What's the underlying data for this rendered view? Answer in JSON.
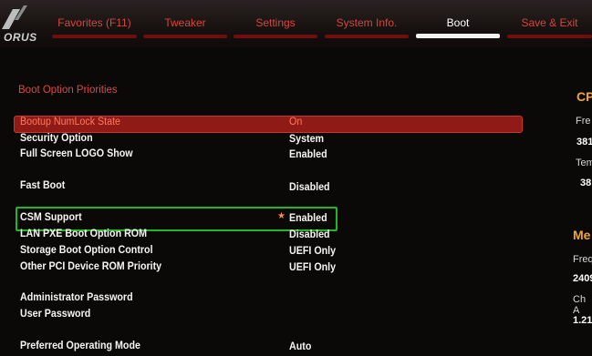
{
  "header": {
    "logo_text": "ORUS",
    "tabs": [
      {
        "label": "Favorites (F11)"
      },
      {
        "label": "Tweaker"
      },
      {
        "label": "Settings"
      },
      {
        "label": "System Info."
      },
      {
        "label": "Boot"
      },
      {
        "label": "Save & Exit"
      }
    ],
    "active_tab": "Boot"
  },
  "main": {
    "section_title": "Boot Option Priorities",
    "options": [
      {
        "label": "Bootup NumLock State",
        "value": "On"
      },
      {
        "label": "Security Option",
        "value": "System"
      },
      {
        "label": "Full Screen LOGO Show",
        "value": "Enabled"
      },
      {
        "label": "Fast Boot",
        "value": "Disabled"
      },
      {
        "label": "CSM Support",
        "value": "Enabled"
      },
      {
        "label": "LAN PXE Boot Option ROM",
        "value": "Disabled"
      },
      {
        "label": "Storage Boot Option Control",
        "value": "UEFI Only"
      },
      {
        "label": "Other PCI Device ROM Priority",
        "value": "UEFI Only"
      },
      {
        "label": "Administrator Password",
        "value": ""
      },
      {
        "label": "User Password",
        "value": ""
      },
      {
        "label": "Preferred Operating Mode",
        "value": "Auto"
      }
    ]
  },
  "right_panel": {
    "cpu_heading": "CP",
    "freq_label": "Fre",
    "freq_value": "381",
    "temp_label": "Tem",
    "temp_value": "38.",
    "mem_heading": "Me",
    "mem_freq_label": "Freq",
    "mem_freq_value": "2409",
    "ch_label": "Ch A",
    "ch_value": "1.21"
  },
  "colors": {
    "accent_red": "#d8453c",
    "highlight_row": "#8f1a16",
    "csm_outline": "#1fb722",
    "panel_heading": "#f2a531"
  }
}
